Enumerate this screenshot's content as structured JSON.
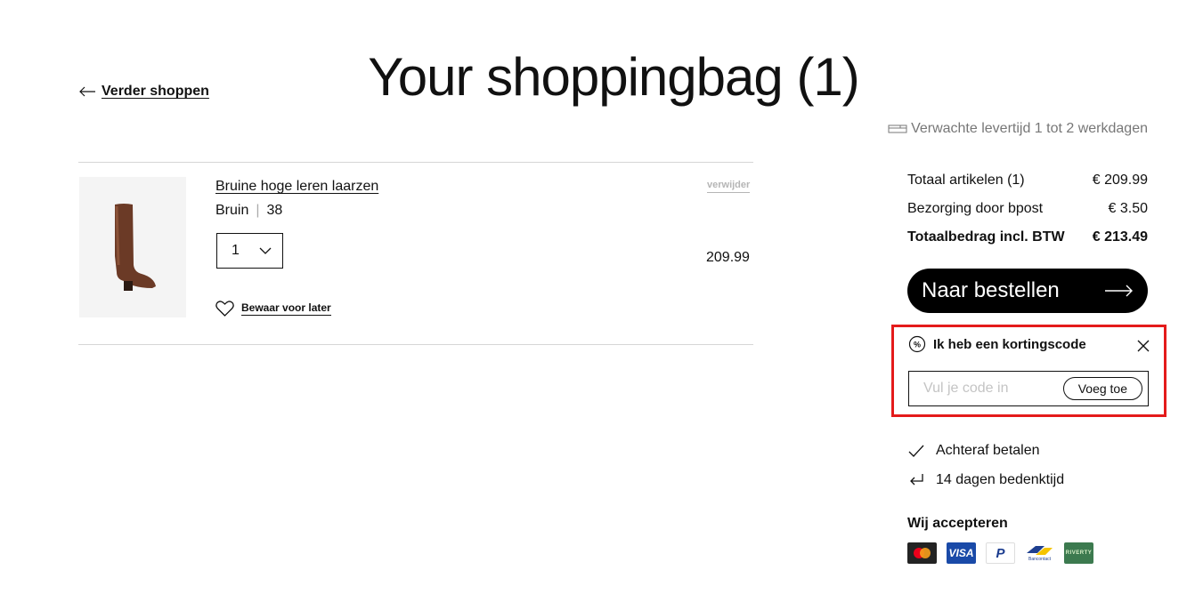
{
  "header": {
    "back_label": "Verder shoppen",
    "title": "Your shoppingbag (1)"
  },
  "delivery": {
    "icon": "truck-icon",
    "text": "Verwachte levertijd 1 tot 2 werkdagen"
  },
  "item": {
    "name": "Bruine hoge leren laarzen",
    "color": "Bruin",
    "size": "38",
    "quantity": "1",
    "price": "209.99",
    "remove_label": "verwijder",
    "save_label": "Bewaar voor later"
  },
  "summary": {
    "rows": [
      {
        "label": "Totaal artikelen (1)",
        "value": "€ 209.99"
      },
      {
        "label": "Bezorging door bpost",
        "value": "€ 3.50"
      },
      {
        "label": "Totaalbedrag incl. BTW",
        "value": "€ 213.49"
      }
    ],
    "checkout_label": "Naar bestellen"
  },
  "coupon": {
    "title": "Ik heb een kortingscode",
    "placeholder": "Vul je code in",
    "apply_label": "Voeg toe",
    "highlight_color": "#e41b1b"
  },
  "perks": [
    {
      "icon": "check-icon",
      "label": "Achteraf betalen"
    },
    {
      "icon": "return-arrow-icon",
      "label": "14 dagen bedenktijd"
    }
  ],
  "payments": {
    "title": "Wij accepteren",
    "methods": [
      "Mastercard",
      "VISA",
      "PayPal",
      "Bancontact",
      "RIVERTY"
    ]
  }
}
